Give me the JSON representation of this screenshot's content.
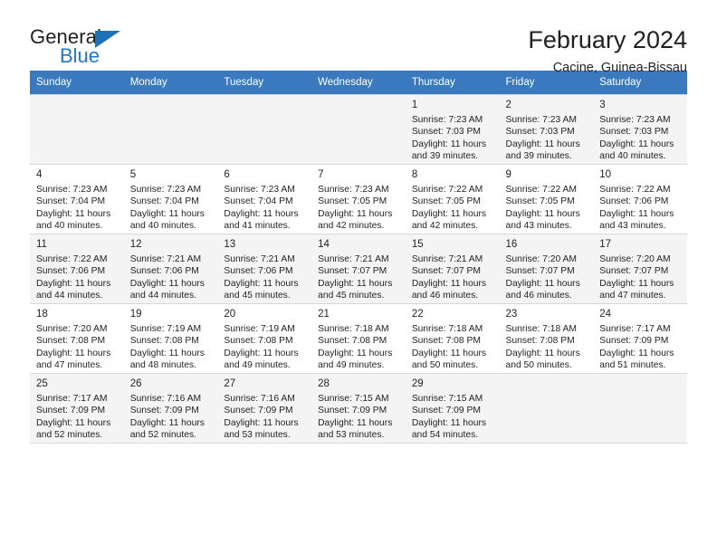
{
  "brand": {
    "name_part1": "General",
    "name_part2": "Blue",
    "logo_icon": "triangle-logo-icon"
  },
  "header": {
    "title": "February 2024",
    "subtitle": "Cacine, Guinea-Bissau"
  },
  "calendar": {
    "accent_color": "#3a79bd",
    "alt_row_color": "#f4f4f4",
    "weekday_headers": [
      "Sunday",
      "Monday",
      "Tuesday",
      "Wednesday",
      "Thursday",
      "Friday",
      "Saturday"
    ],
    "weeks": [
      [
        {
          "day": "",
          "sunrise": "",
          "sunset": "",
          "daylight1": "",
          "daylight2": ""
        },
        {
          "day": "",
          "sunrise": "",
          "sunset": "",
          "daylight1": "",
          "daylight2": ""
        },
        {
          "day": "",
          "sunrise": "",
          "sunset": "",
          "daylight1": "",
          "daylight2": ""
        },
        {
          "day": "",
          "sunrise": "",
          "sunset": "",
          "daylight1": "",
          "daylight2": ""
        },
        {
          "day": "1",
          "sunrise": "Sunrise: 7:23 AM",
          "sunset": "Sunset: 7:03 PM",
          "daylight1": "Daylight: 11 hours",
          "daylight2": "and 39 minutes."
        },
        {
          "day": "2",
          "sunrise": "Sunrise: 7:23 AM",
          "sunset": "Sunset: 7:03 PM",
          "daylight1": "Daylight: 11 hours",
          "daylight2": "and 39 minutes."
        },
        {
          "day": "3",
          "sunrise": "Sunrise: 7:23 AM",
          "sunset": "Sunset: 7:03 PM",
          "daylight1": "Daylight: 11 hours",
          "daylight2": "and 40 minutes."
        }
      ],
      [
        {
          "day": "4",
          "sunrise": "Sunrise: 7:23 AM",
          "sunset": "Sunset: 7:04 PM",
          "daylight1": "Daylight: 11 hours",
          "daylight2": "and 40 minutes."
        },
        {
          "day": "5",
          "sunrise": "Sunrise: 7:23 AM",
          "sunset": "Sunset: 7:04 PM",
          "daylight1": "Daylight: 11 hours",
          "daylight2": "and 40 minutes."
        },
        {
          "day": "6",
          "sunrise": "Sunrise: 7:23 AM",
          "sunset": "Sunset: 7:04 PM",
          "daylight1": "Daylight: 11 hours",
          "daylight2": "and 41 minutes."
        },
        {
          "day": "7",
          "sunrise": "Sunrise: 7:23 AM",
          "sunset": "Sunset: 7:05 PM",
          "daylight1": "Daylight: 11 hours",
          "daylight2": "and 42 minutes."
        },
        {
          "day": "8",
          "sunrise": "Sunrise: 7:22 AM",
          "sunset": "Sunset: 7:05 PM",
          "daylight1": "Daylight: 11 hours",
          "daylight2": "and 42 minutes."
        },
        {
          "day": "9",
          "sunrise": "Sunrise: 7:22 AM",
          "sunset": "Sunset: 7:05 PM",
          "daylight1": "Daylight: 11 hours",
          "daylight2": "and 43 minutes."
        },
        {
          "day": "10",
          "sunrise": "Sunrise: 7:22 AM",
          "sunset": "Sunset: 7:06 PM",
          "daylight1": "Daylight: 11 hours",
          "daylight2": "and 43 minutes."
        }
      ],
      [
        {
          "day": "11",
          "sunrise": "Sunrise: 7:22 AM",
          "sunset": "Sunset: 7:06 PM",
          "daylight1": "Daylight: 11 hours",
          "daylight2": "and 44 minutes."
        },
        {
          "day": "12",
          "sunrise": "Sunrise: 7:21 AM",
          "sunset": "Sunset: 7:06 PM",
          "daylight1": "Daylight: 11 hours",
          "daylight2": "and 44 minutes."
        },
        {
          "day": "13",
          "sunrise": "Sunrise: 7:21 AM",
          "sunset": "Sunset: 7:06 PM",
          "daylight1": "Daylight: 11 hours",
          "daylight2": "and 45 minutes."
        },
        {
          "day": "14",
          "sunrise": "Sunrise: 7:21 AM",
          "sunset": "Sunset: 7:07 PM",
          "daylight1": "Daylight: 11 hours",
          "daylight2": "and 45 minutes."
        },
        {
          "day": "15",
          "sunrise": "Sunrise: 7:21 AM",
          "sunset": "Sunset: 7:07 PM",
          "daylight1": "Daylight: 11 hours",
          "daylight2": "and 46 minutes."
        },
        {
          "day": "16",
          "sunrise": "Sunrise: 7:20 AM",
          "sunset": "Sunset: 7:07 PM",
          "daylight1": "Daylight: 11 hours",
          "daylight2": "and 46 minutes."
        },
        {
          "day": "17",
          "sunrise": "Sunrise: 7:20 AM",
          "sunset": "Sunset: 7:07 PM",
          "daylight1": "Daylight: 11 hours",
          "daylight2": "and 47 minutes."
        }
      ],
      [
        {
          "day": "18",
          "sunrise": "Sunrise: 7:20 AM",
          "sunset": "Sunset: 7:08 PM",
          "daylight1": "Daylight: 11 hours",
          "daylight2": "and 47 minutes."
        },
        {
          "day": "19",
          "sunrise": "Sunrise: 7:19 AM",
          "sunset": "Sunset: 7:08 PM",
          "daylight1": "Daylight: 11 hours",
          "daylight2": "and 48 minutes."
        },
        {
          "day": "20",
          "sunrise": "Sunrise: 7:19 AM",
          "sunset": "Sunset: 7:08 PM",
          "daylight1": "Daylight: 11 hours",
          "daylight2": "and 49 minutes."
        },
        {
          "day": "21",
          "sunrise": "Sunrise: 7:18 AM",
          "sunset": "Sunset: 7:08 PM",
          "daylight1": "Daylight: 11 hours",
          "daylight2": "and 49 minutes."
        },
        {
          "day": "22",
          "sunrise": "Sunrise: 7:18 AM",
          "sunset": "Sunset: 7:08 PM",
          "daylight1": "Daylight: 11 hours",
          "daylight2": "and 50 minutes."
        },
        {
          "day": "23",
          "sunrise": "Sunrise: 7:18 AM",
          "sunset": "Sunset: 7:08 PM",
          "daylight1": "Daylight: 11 hours",
          "daylight2": "and 50 minutes."
        },
        {
          "day": "24",
          "sunrise": "Sunrise: 7:17 AM",
          "sunset": "Sunset: 7:09 PM",
          "daylight1": "Daylight: 11 hours",
          "daylight2": "and 51 minutes."
        }
      ],
      [
        {
          "day": "25",
          "sunrise": "Sunrise: 7:17 AM",
          "sunset": "Sunset: 7:09 PM",
          "daylight1": "Daylight: 11 hours",
          "daylight2": "and 52 minutes."
        },
        {
          "day": "26",
          "sunrise": "Sunrise: 7:16 AM",
          "sunset": "Sunset: 7:09 PM",
          "daylight1": "Daylight: 11 hours",
          "daylight2": "and 52 minutes."
        },
        {
          "day": "27",
          "sunrise": "Sunrise: 7:16 AM",
          "sunset": "Sunset: 7:09 PM",
          "daylight1": "Daylight: 11 hours",
          "daylight2": "and 53 minutes."
        },
        {
          "day": "28",
          "sunrise": "Sunrise: 7:15 AM",
          "sunset": "Sunset: 7:09 PM",
          "daylight1": "Daylight: 11 hours",
          "daylight2": "and 53 minutes."
        },
        {
          "day": "29",
          "sunrise": "Sunrise: 7:15 AM",
          "sunset": "Sunset: 7:09 PM",
          "daylight1": "Daylight: 11 hours",
          "daylight2": "and 54 minutes."
        },
        {
          "day": "",
          "sunrise": "",
          "sunset": "",
          "daylight1": "",
          "daylight2": ""
        },
        {
          "day": "",
          "sunrise": "",
          "sunset": "",
          "daylight1": "",
          "daylight2": ""
        }
      ]
    ]
  }
}
